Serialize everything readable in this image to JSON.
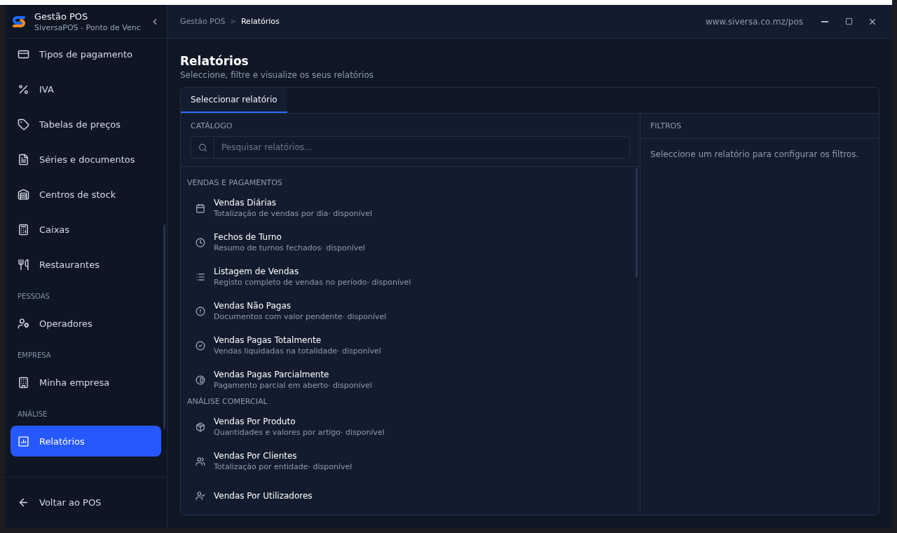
{
  "window": {
    "brand_title": "Gestão POS",
    "brand_subtitle": "SiversaPOS - Ponto de Venc",
    "url": "www.siversa.co.mz/pos"
  },
  "breadcrumb": {
    "items": [
      "Gestão POS",
      "Relatórios"
    ],
    "separator": ">"
  },
  "sidebar": {
    "items": [
      {
        "kind": "link",
        "label": "Tipos de pagamento",
        "selected": false
      },
      {
        "kind": "link",
        "label": "IVA",
        "selected": false
      },
      {
        "kind": "link",
        "label": "Tabelas de preços",
        "selected": false
      },
      {
        "kind": "link",
        "label": "Séries e documentos",
        "selected": false
      },
      {
        "kind": "link",
        "label": "Centros de stock",
        "selected": false
      },
      {
        "kind": "link",
        "label": "Caixas",
        "selected": false
      },
      {
        "kind": "link",
        "label": "Restaurantes",
        "selected": false
      },
      {
        "kind": "section",
        "label": "PESSOAS"
      },
      {
        "kind": "link",
        "label": "Operadores",
        "selected": false
      },
      {
        "kind": "section",
        "label": "EMPRESA"
      },
      {
        "kind": "link",
        "label": "Minha empresa",
        "selected": false
      },
      {
        "kind": "section",
        "label": "ANÁLISE"
      },
      {
        "kind": "link",
        "label": "Relatórios",
        "selected": true
      }
    ],
    "footer": "Voltar ao POS"
  },
  "page": {
    "title": "Relatórios",
    "subtitle": "Seleccione, filtre e visualize os seus relatórios"
  },
  "tabs": [
    {
      "label": "Seleccionar relatório",
      "selected": true
    }
  ],
  "catalog": {
    "label": "CATÁLOGO",
    "search_placeholder": "Pesquisar relatórios...",
    "groups": [
      {
        "title": "VENDAS E PAGAMENTOS",
        "reports": [
          {
            "title": "Vendas Diárias",
            "description": "Totalização de vendas por dia· disponível"
          },
          {
            "title": "Fechos de Turno",
            "description": "Resumo de turnos fechados· disponível"
          },
          {
            "title": "Listagem de Vendas",
            "description": "Registo completo de vendas no período· disponível"
          },
          {
            "title": "Vendas Não Pagas",
            "description": "Documentos com valor pendente· disponível"
          },
          {
            "title": "Vendas Pagas Totalmente",
            "description": "Vendas liquidadas na totalidade· disponível"
          },
          {
            "title": "Vendas Pagas Parcialmente",
            "description": "Pagamento parcial em aberto· disponível"
          }
        ]
      },
      {
        "title": "ANÁLISE COMERCIAL",
        "reports": [
          {
            "title": "Vendas Por Produto",
            "description": "Quantidades e valores por artigo· disponível"
          },
          {
            "title": "Vendas Por Clientes",
            "description": "Totalização por entidade· disponível"
          },
          {
            "title": "Vendas Por Utilizadores"
          }
        ]
      }
    ]
  },
  "filters": {
    "label": "FILTROS",
    "message": "Seleccione um relatório para configurar os filtros."
  }
}
